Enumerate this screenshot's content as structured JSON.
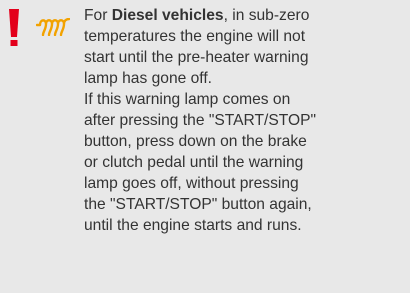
{
  "colors": {
    "background": "#e8e8e8",
    "text": "#333333",
    "warning": "#e3001b",
    "preheat_icon": "#f2a200"
  },
  "icons": {
    "warning": "exclamation-mark-icon",
    "preheat": "diesel-preheater-coil-icon"
  },
  "paragraph1": {
    "intro": "For ",
    "bold": "Diesel vehicles",
    "line1_rest": ", in sub-zero",
    "lines": [
      "temperatures the engine will not",
      "start until the pre-heater warning",
      "lamp has gone off."
    ]
  },
  "paragraph2": {
    "lines": [
      "If this warning lamp comes on",
      "after pressing the \"START/STOP\"",
      "button, press down on the brake",
      "or clutch pedal until the warning",
      "lamp goes off, without pressing",
      "the \"START/STOP\" button again,",
      "until the engine starts and runs."
    ]
  }
}
